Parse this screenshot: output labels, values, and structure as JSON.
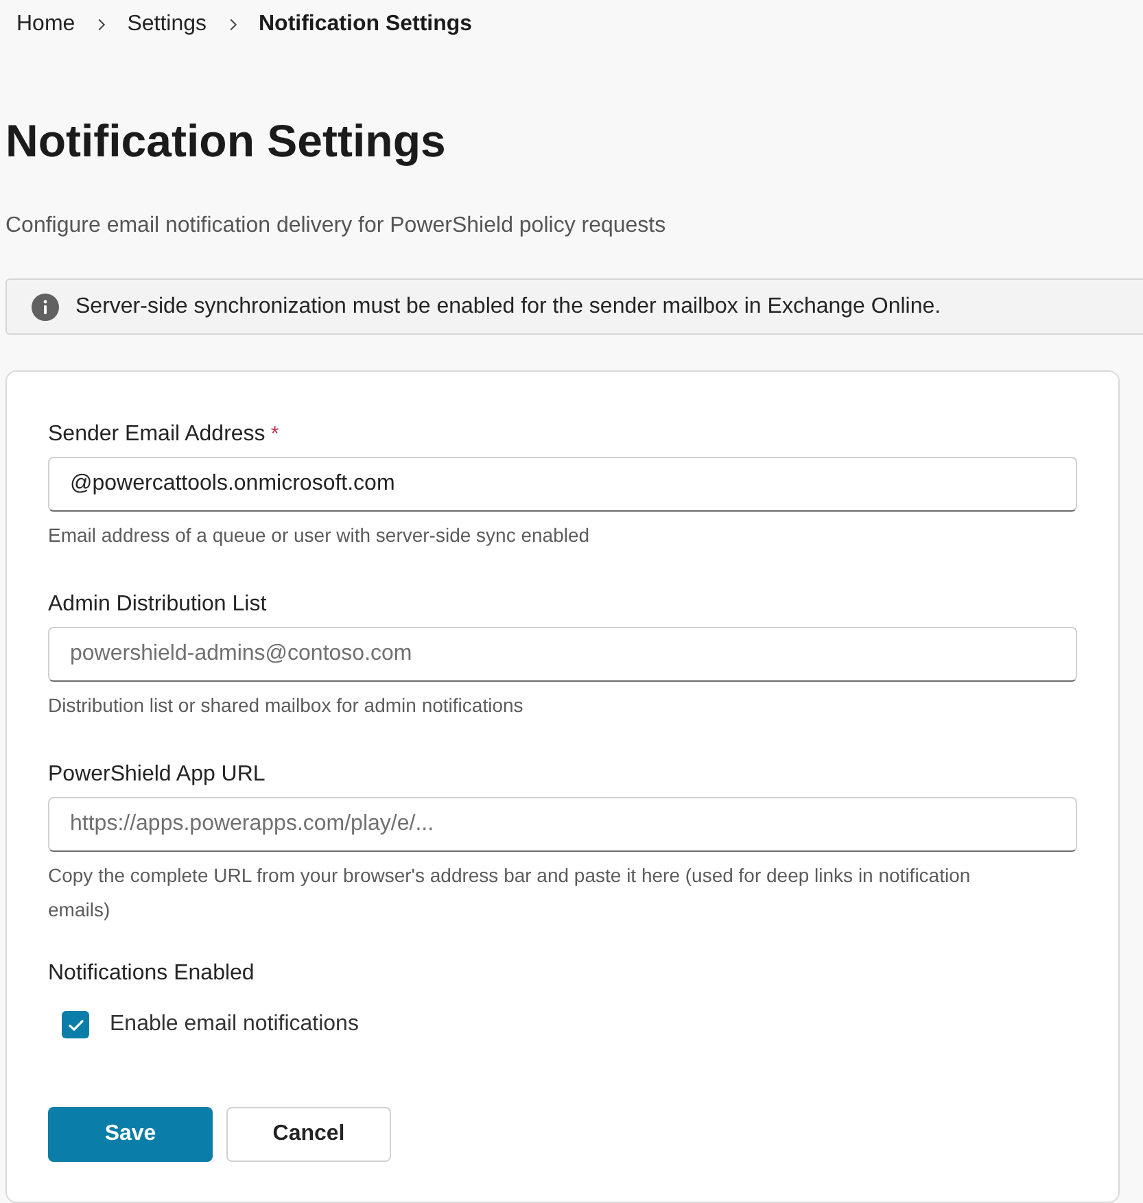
{
  "breadcrumb": [
    {
      "label": "Home",
      "current": false
    },
    {
      "label": "Settings",
      "current": false
    },
    {
      "label": "Notification Settings",
      "current": true
    }
  ],
  "title": "Notification Settings",
  "description": "Configure email notification delivery for PowerShield policy requests",
  "info_banner": {
    "text": "Server-side synchronization must be enabled for the sender mailbox in Exchange Online."
  },
  "form": {
    "fields": [
      {
        "label": "Sender Email Address",
        "required_mark": "*",
        "value": "@powercattools.onmicrosoft.com",
        "help": "Email address of a queue or user with server-side sync enabled"
      },
      {
        "label": "Admin Distribution List",
        "placeholder": "powershield-admins@contoso.com",
        "help": "Distribution list or shared mailbox for admin notifications"
      },
      {
        "label": "PowerShield App URL",
        "placeholder": "https://apps.powerapps.com/play/e/...",
        "help": "Copy the complete URL from your browser's address bar and paste it here (used for deep links in notification emails)"
      }
    ],
    "notifications": {
      "label": "Notifications Enabled",
      "checkbox": {
        "label": "Enable email notifications",
        "checked": true
      }
    },
    "buttons": [
      {
        "label": "Save",
        "kind": "primary"
      },
      {
        "label": "Cancel",
        "kind": "secondary"
      }
    ]
  }
}
